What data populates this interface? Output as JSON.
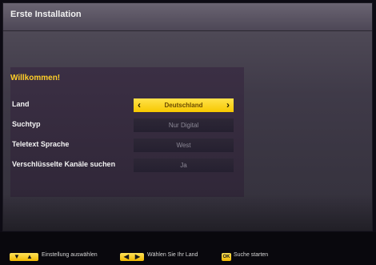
{
  "window": {
    "title": "Erste Installation"
  },
  "welcome": {
    "heading": "Willkommen!"
  },
  "settings": [
    {
      "label": "Land",
      "value": "Deutschland"
    },
    {
      "label": "Suchtyp",
      "value": "Nur Digital"
    },
    {
      "label": "Teletext Sprache",
      "value": "West"
    },
    {
      "label": "Verschlüsselte Kanäle suchen",
      "value": "Ja"
    }
  ],
  "footer": {
    "hints": [
      {
        "keys": "up-down-arrow-icons",
        "label": "Einstellung auswählen"
      },
      {
        "keys": "left-right-arrow-icons",
        "label": "Wählen Sie Ihr Land"
      },
      {
        "keys": "ok-key-icon",
        "label": "Suche starten",
        "key_text": "OK"
      }
    ]
  },
  "colors": {
    "accent": "#ffd21f",
    "panel": "#3b2f44",
    "background": "#0d0b14"
  }
}
